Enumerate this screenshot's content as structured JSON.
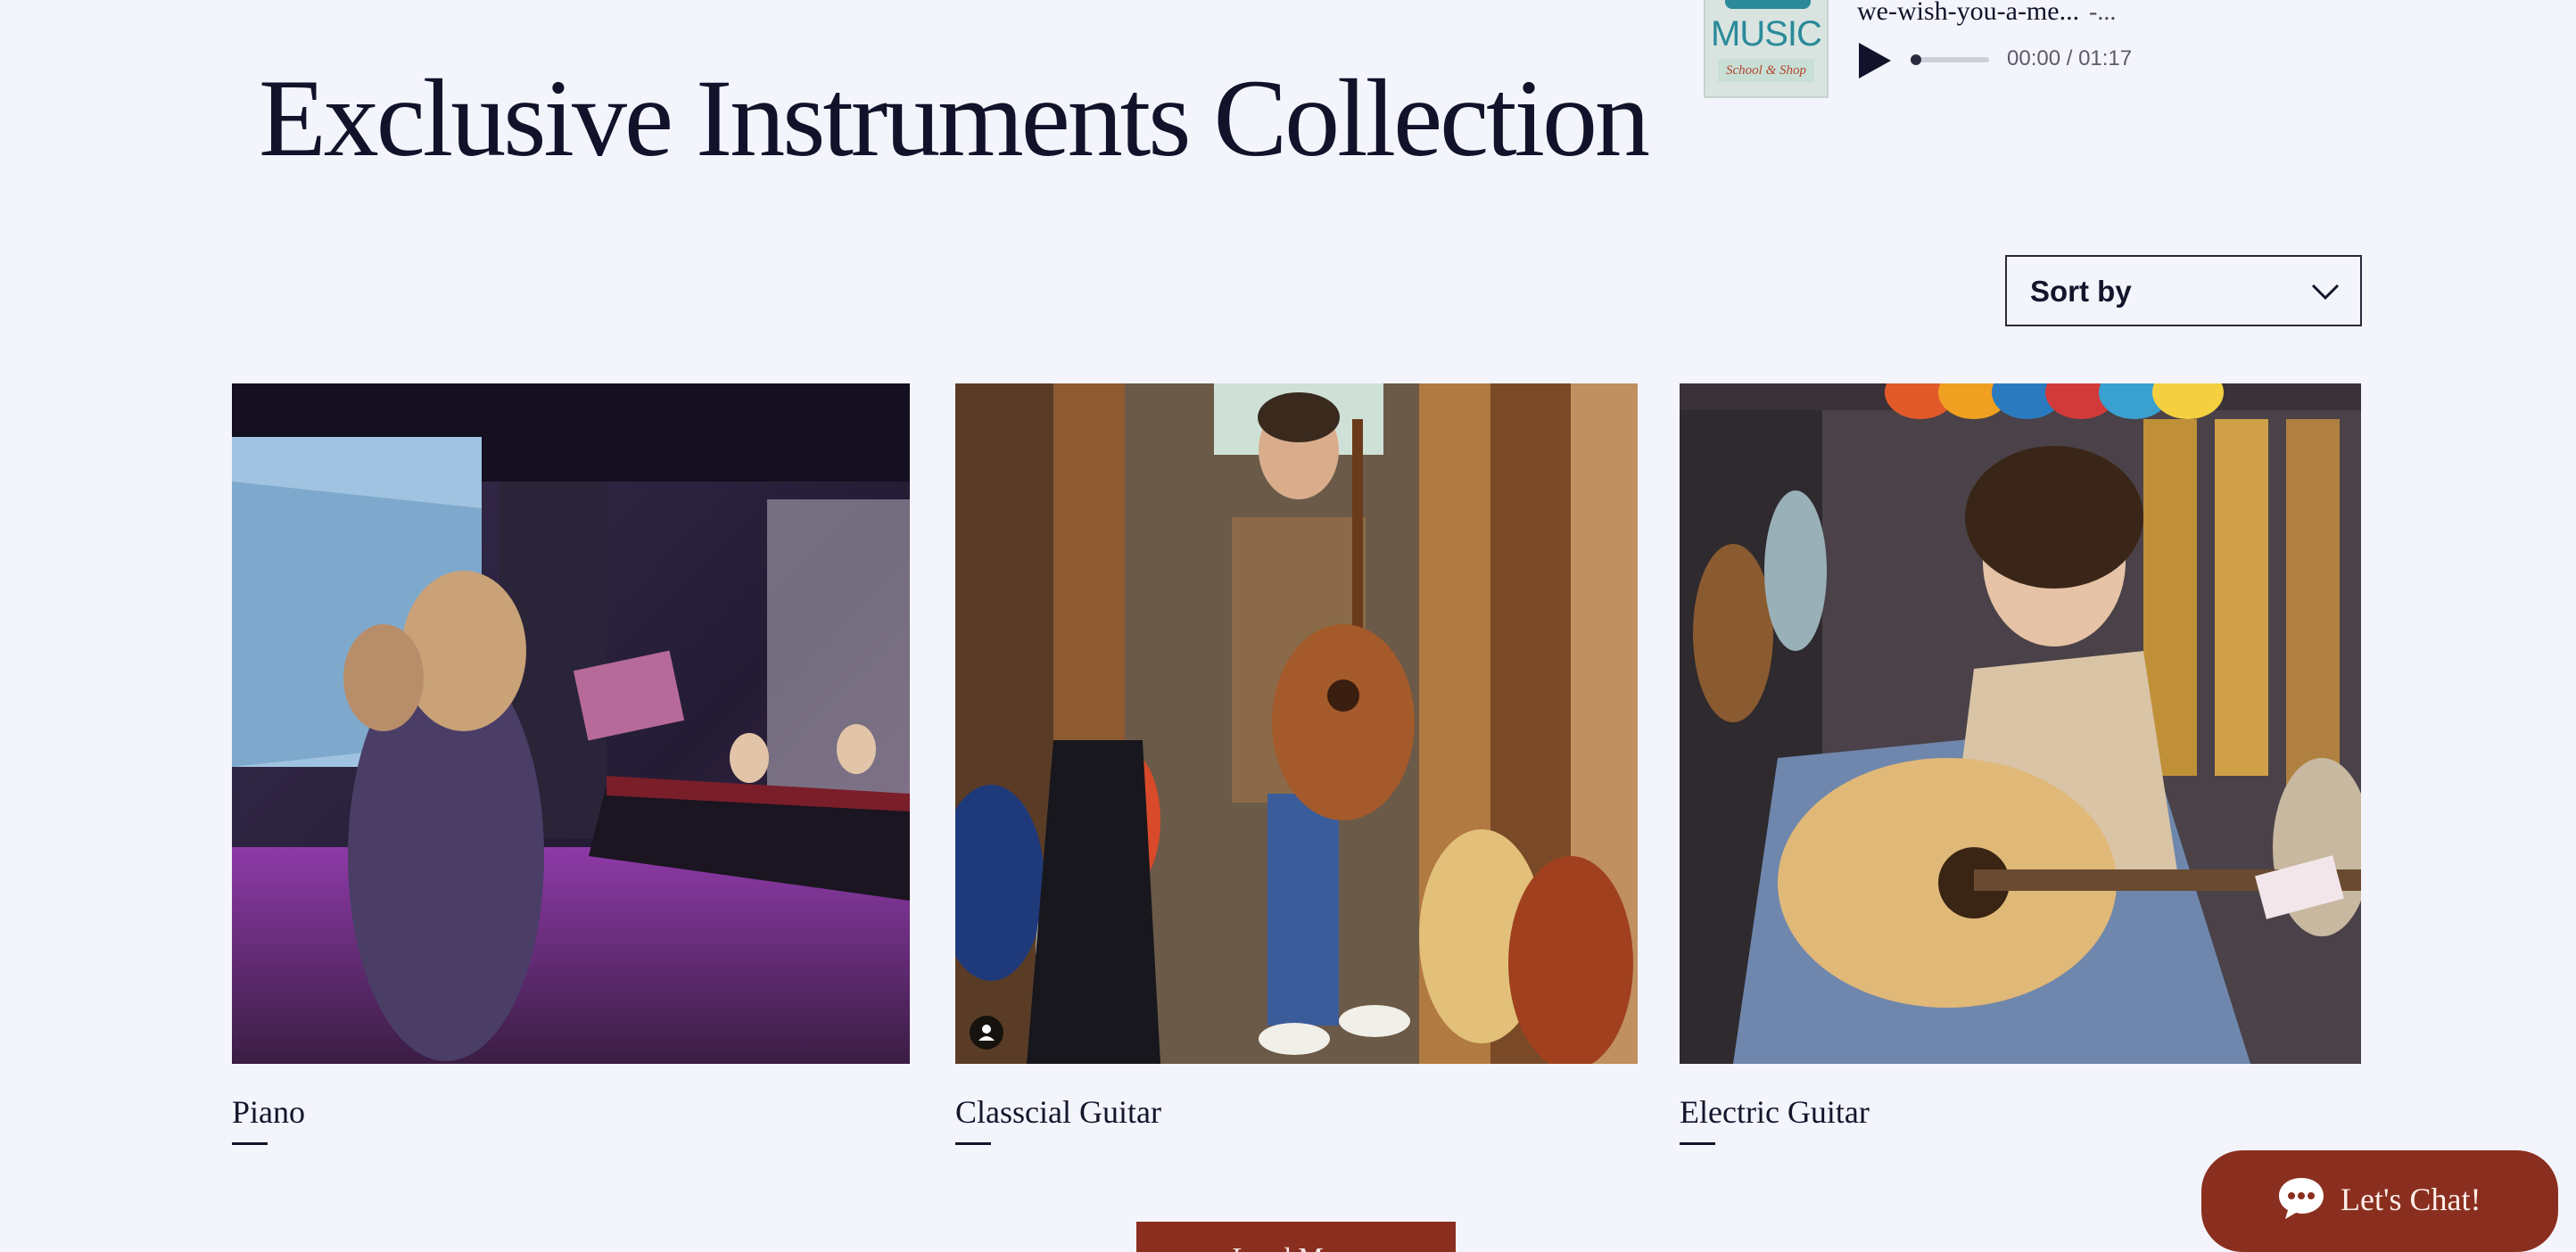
{
  "page": {
    "title": "Exclusive Instruments Collection"
  },
  "player": {
    "cover_word": "MUSIC",
    "cover_tag": "School & Shop",
    "track_title": "we-wish-you-a-me...",
    "track_artist": "-...",
    "time": "00:00 / 01:17",
    "progress": 0.0
  },
  "sort": {
    "label": "Sort by"
  },
  "products": [
    {
      "name": "Piano"
    },
    {
      "name": "Classcial Guitar"
    },
    {
      "name": "Electric Guitar"
    }
  ],
  "load_more": {
    "label": "Load More"
  },
  "chat": {
    "label": "Let's Chat!"
  },
  "colors": {
    "background": "#f4f4fd",
    "text": "#12122a",
    "accent": "#8a2f1f"
  }
}
